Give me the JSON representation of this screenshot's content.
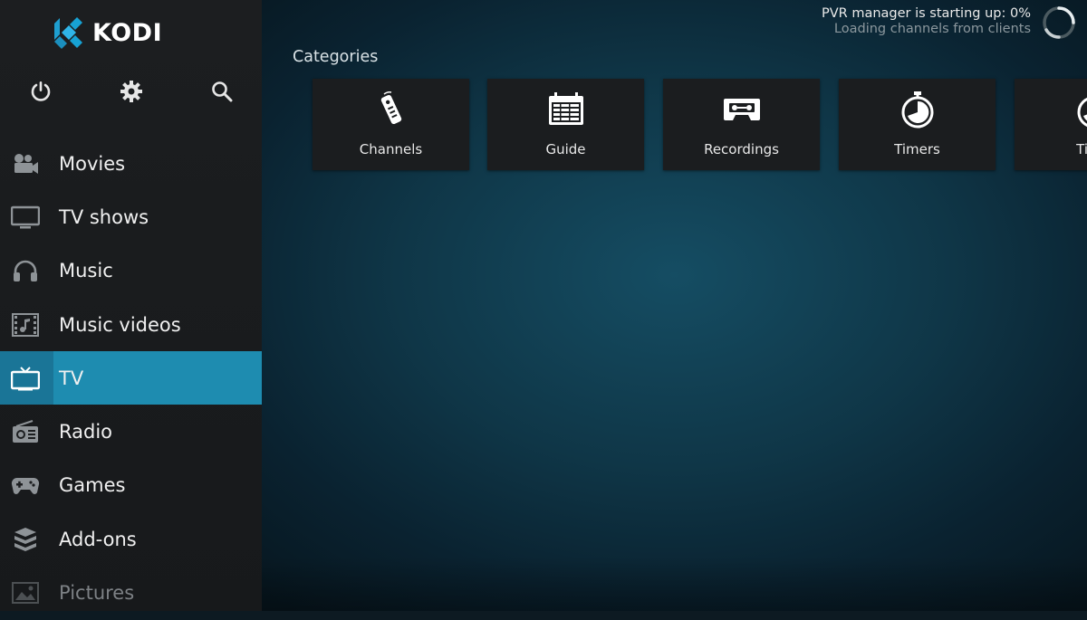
{
  "app": {
    "name": "KODI"
  },
  "colors": {
    "accent": "#1e8cb0",
    "sidebar": "#1c1e20",
    "tile": "#1b1d1f"
  },
  "status": {
    "title": "PVR manager is starting up:  0%",
    "subtitle": "Loading channels from clients"
  },
  "top_icons": [
    "power-icon",
    "settings-gear-icon",
    "search-icon"
  ],
  "menu": {
    "items": [
      {
        "label": "Movies",
        "icon": "movie-camera-icon"
      },
      {
        "label": "TV shows",
        "icon": "monitor-icon"
      },
      {
        "label": "Music",
        "icon": "headphones-icon"
      },
      {
        "label": "Music videos",
        "icon": "music-video-icon"
      },
      {
        "label": "TV",
        "icon": "tv-icon",
        "active": true
      },
      {
        "label": "Radio",
        "icon": "radio-icon"
      },
      {
        "label": "Games",
        "icon": "gamepad-icon"
      },
      {
        "label": "Add-ons",
        "icon": "addons-box-icon"
      },
      {
        "label": "Pictures",
        "icon": "picture-icon"
      }
    ]
  },
  "categories": {
    "heading": "Categories",
    "tiles": [
      {
        "label": "Channels",
        "icon": "remote-control-icon"
      },
      {
        "label": "Guide",
        "icon": "guide-calendar-icon"
      },
      {
        "label": "Recordings",
        "icon": "cassette-icon"
      },
      {
        "label": "Timers",
        "icon": "stopwatch-icon"
      },
      {
        "label": "Time",
        "icon": "stopwatch-icon"
      }
    ]
  }
}
